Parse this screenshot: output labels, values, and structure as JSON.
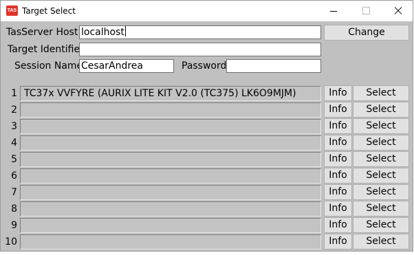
{
  "window": {
    "title": "Target Select",
    "icon_label": "TAS"
  },
  "form": {
    "host_label": "TasServer Host:",
    "host_value": "localhost",
    "target_id_label": "Target Identifier",
    "target_id_value": "",
    "session_label": "Session Name",
    "session_value": "CesarAndrea",
    "password_label": "Password",
    "password_value": "",
    "change_label": "Change"
  },
  "targets": [
    {
      "index": "1",
      "name": "TC37x VVFYRE (AURIX LITE KIT V2.0 (TC375) LK6O9MJM)",
      "info": "Info",
      "select": "Select"
    },
    {
      "index": "2",
      "name": "",
      "info": "Info",
      "select": "Select"
    },
    {
      "index": "3",
      "name": "",
      "info": "Info",
      "select": "Select"
    },
    {
      "index": "4",
      "name": "",
      "info": "Info",
      "select": "Select"
    },
    {
      "index": "5",
      "name": "",
      "info": "Info",
      "select": "Select"
    },
    {
      "index": "6",
      "name": "",
      "info": "Info",
      "select": "Select"
    },
    {
      "index": "7",
      "name": "",
      "info": "Info",
      "select": "Select"
    },
    {
      "index": "8",
      "name": "",
      "info": "Info",
      "select": "Select"
    },
    {
      "index": "9",
      "name": "",
      "info": "Info",
      "select": "Select"
    },
    {
      "index": "10",
      "name": "",
      "info": "Info",
      "select": "Select"
    }
  ],
  "colors": {
    "app_icon": "#e0332b",
    "window_bg": "#c0c0c0"
  }
}
